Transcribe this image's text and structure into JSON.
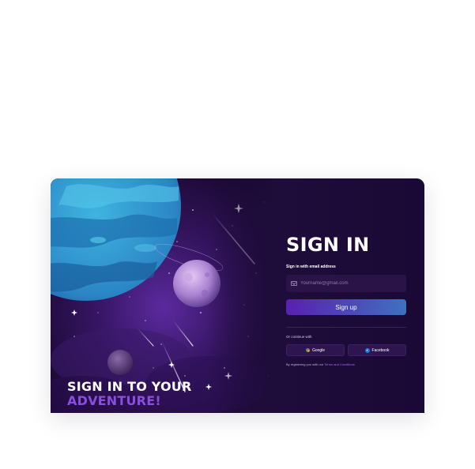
{
  "hero": {
    "title_line1": "SIGN IN TO YOUR",
    "title_line2": "ADVENTURE!"
  },
  "form": {
    "title": "SIGN IN",
    "email_label": "Sign in with email address",
    "email_placeholder": "Yourname@gmail.com",
    "email_value": "",
    "signup_label": "Sign up",
    "continue_label": "Or continue with",
    "google_label": "Google",
    "facebook_label": "Facebook",
    "terms_prefix": "By registering you with our",
    "terms_link": "Terms and Conditions"
  },
  "icons": {
    "mail": "mail-icon",
    "google": "google-icon",
    "facebook": "facebook-icon"
  },
  "colors": {
    "panel_bg": "#1a0933",
    "accent": "#8a4de0",
    "button_start": "#5a20b0",
    "button_end": "#3f71c2",
    "link": "#9b6ef0"
  }
}
